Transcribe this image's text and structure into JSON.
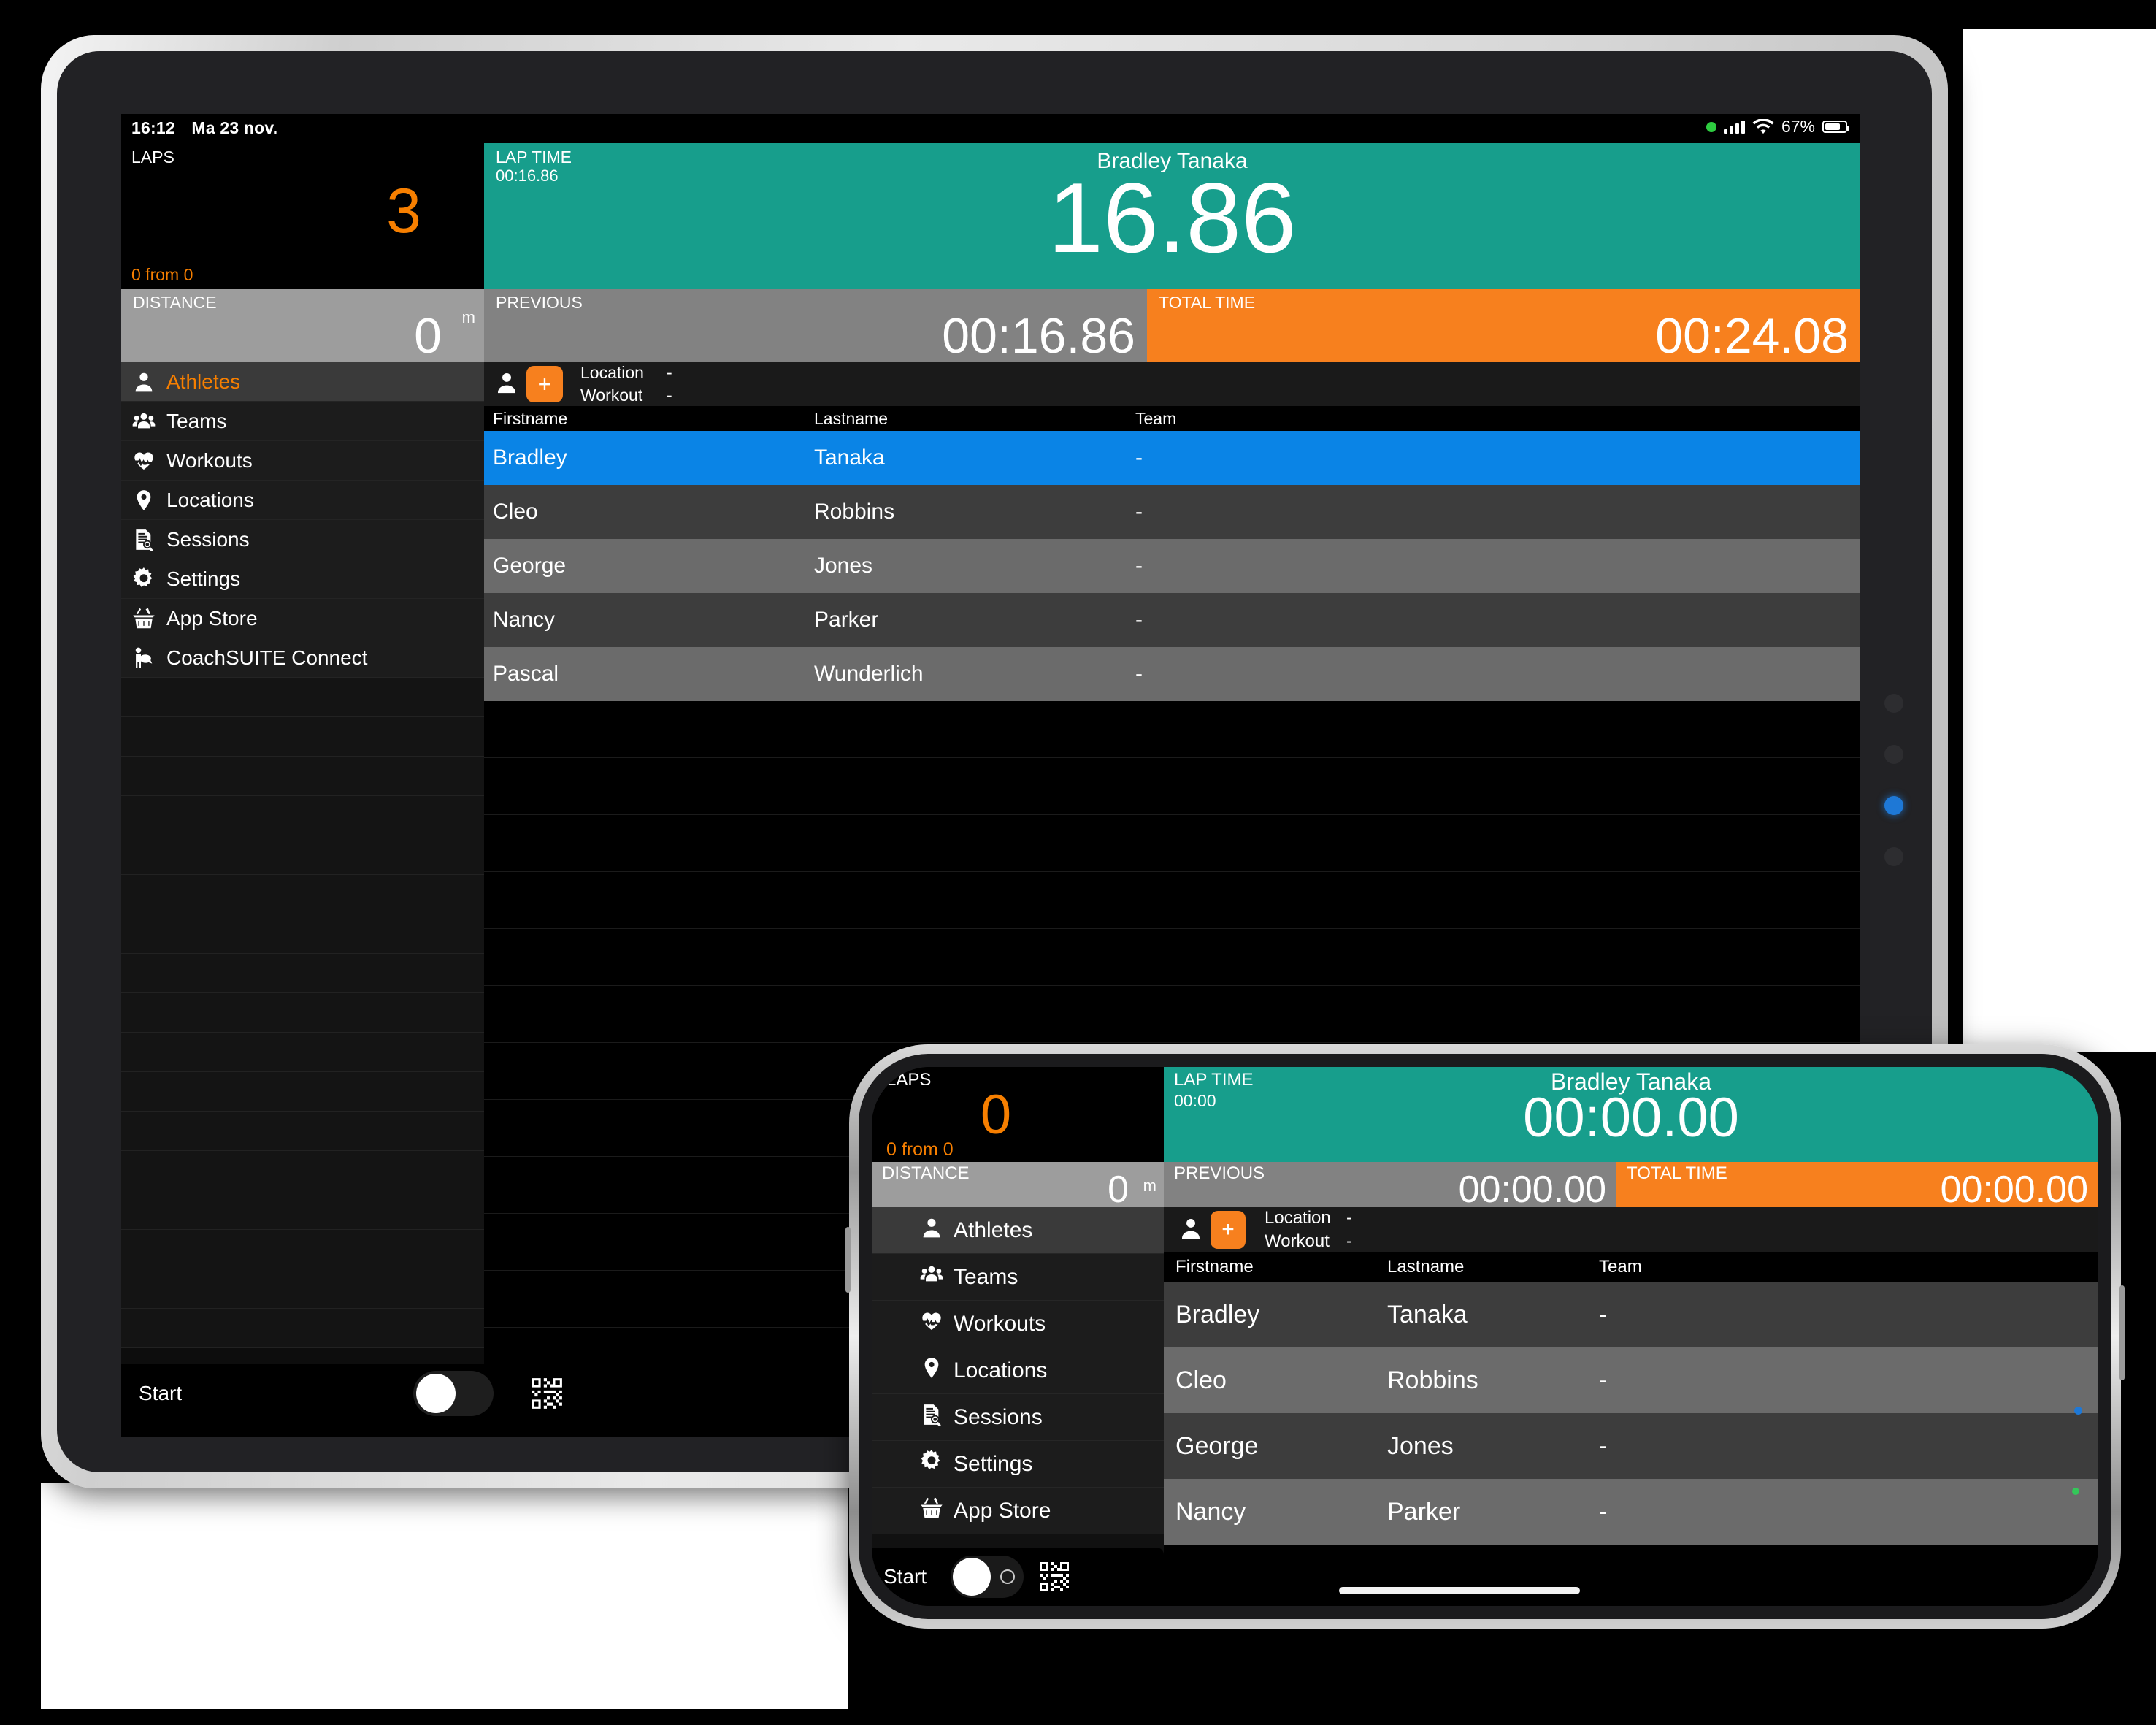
{
  "tablet": {
    "statusbar": {
      "time": "16:12",
      "date": "Ma 23 nov.",
      "battery": "67%"
    },
    "laps": {
      "caption": "LAPS",
      "value": "3",
      "sub": "0 from 0"
    },
    "lap_time": {
      "caption": "LAP TIME",
      "small_value": "00:16.86",
      "athlete": "Bradley Tanaka",
      "value": "16.86"
    },
    "distance": {
      "caption": "DISTANCE",
      "value": "0",
      "unit": "m"
    },
    "previous": {
      "caption": "PREVIOUS",
      "value": "00:16.86"
    },
    "total_time": {
      "caption": "TOTAL TIME",
      "value": "00:24.08"
    },
    "sidebar": {
      "items": [
        {
          "label": "Athletes",
          "icon": "person-icon",
          "selected": true
        },
        {
          "label": "Teams",
          "icon": "people-group-icon",
          "selected": false
        },
        {
          "label": "Workouts",
          "icon": "heart-pulse-icon",
          "selected": false
        },
        {
          "label": "Locations",
          "icon": "map-pin-icon",
          "selected": false
        },
        {
          "label": "Sessions",
          "icon": "document-search-icon",
          "selected": false
        },
        {
          "label": "Settings",
          "icon": "gear-icon",
          "selected": false
        },
        {
          "label": "App Store",
          "icon": "shopping-basket-icon",
          "selected": false
        },
        {
          "label": "CoachSUITE Connect",
          "icon": "coach-connect-icon",
          "selected": false
        }
      ]
    },
    "list_toolbar": {
      "person_icon": "person-icon",
      "add_label": "+",
      "location_label": "Location",
      "location_value": "-",
      "workout_label": "Workout",
      "workout_value": "-"
    },
    "table": {
      "headers": [
        "Firstname",
        "Lastname",
        "Team"
      ],
      "rows": [
        {
          "firstname": "Bradley",
          "lastname": "Tanaka",
          "team": "-"
        },
        {
          "firstname": "Cleo",
          "lastname": "Robbins",
          "team": "-"
        },
        {
          "firstname": "George",
          "lastname": "Jones",
          "team": "-"
        },
        {
          "firstname": "Nancy",
          "lastname": "Parker",
          "team": "-"
        },
        {
          "firstname": "Pascal",
          "lastname": "Wunderlich",
          "team": "-"
        }
      ]
    },
    "bottombar": {
      "start_label": "Start",
      "toggle_on": true,
      "qr_icon": "qr-code-icon"
    }
  },
  "phone": {
    "laps": {
      "caption": "LAPS",
      "value": "0",
      "sub": "0 from 0"
    },
    "lap_time": {
      "caption": "LAP TIME",
      "small_value": "00:00",
      "athlete": "Bradley Tanaka",
      "value": "00:00.00"
    },
    "distance": {
      "caption": "DISTANCE",
      "value": "0",
      "unit": "m"
    },
    "previous": {
      "caption": "PREVIOUS",
      "value": "00:00.00"
    },
    "total_time": {
      "caption": "TOTAL TIME",
      "value": "00:00.00"
    },
    "sidebar": {
      "items": [
        {
          "label": "Athletes",
          "icon": "person-icon",
          "selected": true
        },
        {
          "label": "Teams",
          "icon": "people-group-icon",
          "selected": false
        },
        {
          "label": "Workouts",
          "icon": "heart-pulse-icon",
          "selected": false
        },
        {
          "label": "Locations",
          "icon": "map-pin-icon",
          "selected": false
        },
        {
          "label": "Sessions",
          "icon": "document-search-icon",
          "selected": false
        },
        {
          "label": "Settings",
          "icon": "gear-icon",
          "selected": false
        },
        {
          "label": "App Store",
          "icon": "shopping-basket-icon",
          "selected": false
        }
      ]
    },
    "list_toolbar": {
      "person_icon": "person-icon",
      "add_label": "+",
      "location_label": "Location",
      "location_value": "-",
      "workout_label": "Workout",
      "workout_value": "-"
    },
    "table": {
      "headers": [
        "Firstname",
        "Lastname",
        "Team"
      ],
      "rows": [
        {
          "firstname": "Bradley",
          "lastname": "Tanaka",
          "team": "-"
        },
        {
          "firstname": "Cleo",
          "lastname": "Robbins",
          "team": "-"
        },
        {
          "firstname": "George",
          "lastname": "Jones",
          "team": "-"
        },
        {
          "firstname": "Nancy",
          "lastname": "Parker",
          "team": "-"
        }
      ]
    },
    "bottombar": {
      "start_label": "Start",
      "toggle_on": true,
      "qr_icon": "qr-code-icon"
    }
  },
  "colors": {
    "teal": "#179e8c",
    "orange": "#f7801e",
    "accent_orange_text": "#f77f00",
    "selected_blue": "#0a84e6",
    "row_dark": "#3d3d3d",
    "row_light": "#6b6b6b",
    "distance_gray": "#9d9d9d",
    "previous_gray": "#828282"
  }
}
